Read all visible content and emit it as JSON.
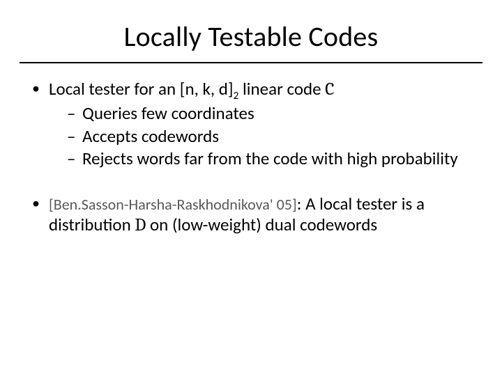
{
  "title": "Locally Testable Codes",
  "bullets": {
    "b1": {
      "pre": "Local tester for an [n, k, d]",
      "sub": "2",
      "mid": " linear code ",
      "C": "C",
      "sub1": "Queries few coordinates",
      "sub2": "Accepts codewords",
      "sub3": "Rejects words far from the code with high probability"
    },
    "b2": {
      "cite": "[Ben.Sasson-Harsha-Raskhodnikova' 05]",
      "sep": ": ",
      "text1": "A local tester is a distribution ",
      "D": "D",
      "text2": " on (low-weight) dual codewords"
    }
  }
}
